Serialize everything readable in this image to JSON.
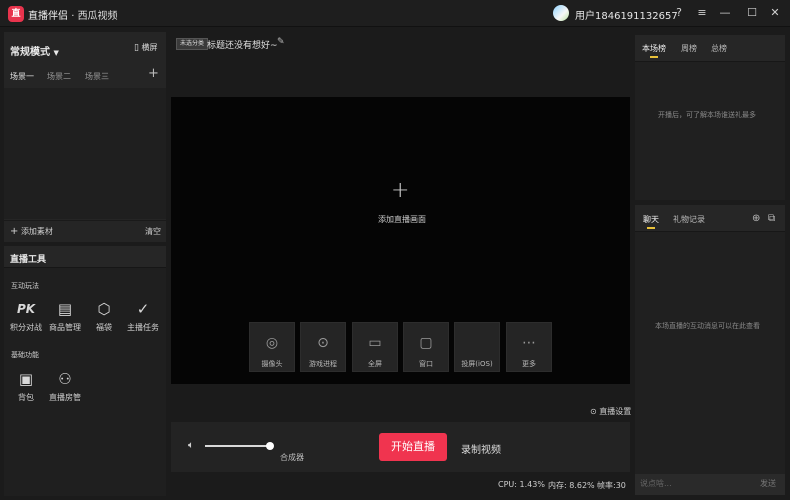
{
  "app": {
    "logo_glyph": "直",
    "name": "直播伴侣",
    "separator": "·",
    "platform": "西瓜视频"
  },
  "user": {
    "name": "用户1846191132657"
  },
  "window_controls": {
    "help": "?",
    "menu": "≡",
    "minimize": "—",
    "maximize": "☐",
    "close": "✕"
  },
  "left": {
    "mode": "常规模式",
    "landscape": "横屏",
    "scenes": [
      "场景一",
      "场景二",
      "场景三"
    ],
    "add_scene": "+",
    "add_material": "添加素材",
    "clear": "清空"
  },
  "tools": {
    "title": "直播工具",
    "interactive_title": "互动玩法",
    "interactive": [
      {
        "icon": "PK",
        "label": "积分对战"
      },
      {
        "icon": "▤",
        "label": "商品管理"
      },
      {
        "icon": "⬡",
        "label": "福袋"
      },
      {
        "icon": "✓",
        "label": "主播任务"
      }
    ],
    "basic_title": "基础功能",
    "basic": [
      {
        "icon": "▣",
        "label": "背包"
      },
      {
        "icon": "⚇",
        "label": "直播房管"
      }
    ]
  },
  "center": {
    "category": "未选分类",
    "title": "标题还没有想好~",
    "add_plus": "+",
    "add_screen": "添加直播画面",
    "sources": [
      {
        "icon": "◎",
        "label": "摄像头"
      },
      {
        "icon": "⊙",
        "label": "游戏进程"
      },
      {
        "icon": "▭",
        "label": "全屏"
      },
      {
        "icon": "▢",
        "label": "窗口"
      },
      {
        "icon": "",
        "label": "投屏(iOS)"
      },
      {
        "icon": "⋯",
        "label": "更多"
      }
    ],
    "live_settings": "直播设置",
    "mixer": "合成器",
    "start_live": "开始直播",
    "record_video": "录制视频",
    "volume_level": 0.95,
    "status": {
      "cpu": "CPU: 1.43%",
      "memory": "内存: 8.62%",
      "fps": "帧率:30"
    }
  },
  "rank": {
    "tabs": [
      "本场榜",
      "周榜",
      "总榜"
    ],
    "empty": "开播后，可了解本场谁送礼最多"
  },
  "chat": {
    "tabs": [
      "聊天",
      "礼物记录"
    ],
    "empty": "本场直播的互动消息可以在此查看",
    "input_placeholder": "说点啥...",
    "send": "发送"
  },
  "colors": {
    "accent": "#f0344f",
    "tab_underline": "#e8c13a"
  }
}
